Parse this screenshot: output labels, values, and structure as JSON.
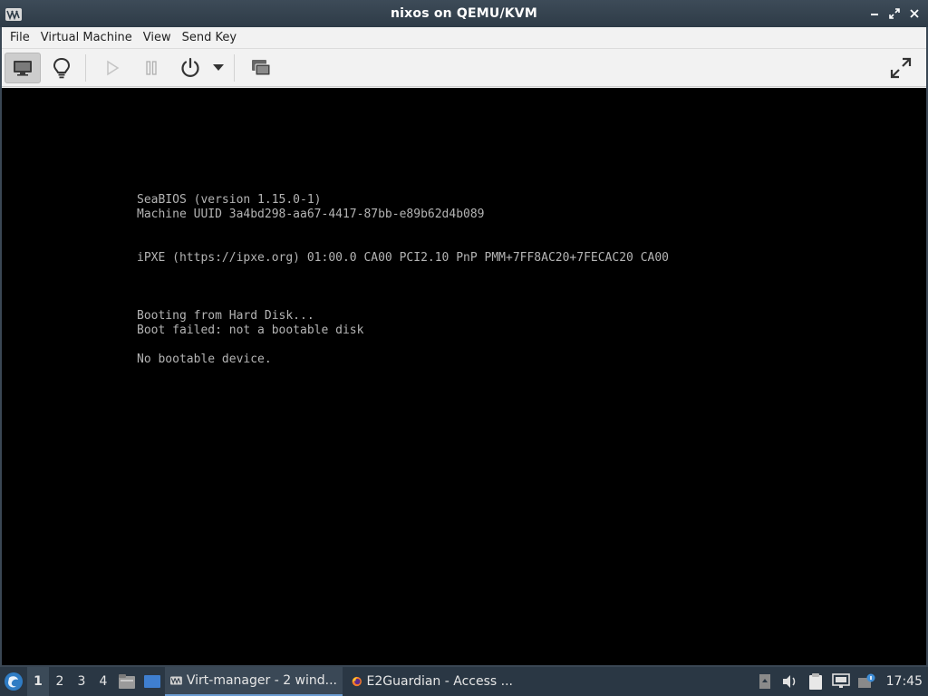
{
  "window": {
    "title": "nixos on QEMU/KVM",
    "app_icon": "virt-manager-icon"
  },
  "menubar": {
    "items": [
      "File",
      "Virtual Machine",
      "View",
      "Send Key"
    ]
  },
  "toolbar": {
    "buttons": [
      "console-view-icon",
      "details-bulb-icon",
      "run-icon",
      "pause-icon",
      "power-icon",
      "dropdown-arrow-icon",
      "snapshots-icon",
      "fullscreen-icon"
    ]
  },
  "console": {
    "lines": [
      "SeaBIOS (version 1.15.0-1)",
      "Machine UUID 3a4bd298-aa67-4417-87bb-e89b62d4b089",
      "iPXE (https://ipxe.org) 01:00.0 CA00 PCI2.10 PnP PMM+7FF8AC20+7FECAC20 CA00",
      "Booting from Hard Disk...",
      "Boot failed: not a bootable disk",
      "No bootable device."
    ],
    "text_color": "#b4b4b4",
    "background": "#000000"
  },
  "taskbar": {
    "workspaces": [
      "1",
      "2",
      "3",
      "4"
    ],
    "active_workspace": "1",
    "tasks": [
      {
        "label": "Virt-manager - 2 wind...",
        "icon": "virt-manager-icon"
      },
      {
        "label": "E2Guardian - Access ...",
        "icon": "firefox-icon"
      }
    ],
    "clock": "17:45"
  }
}
